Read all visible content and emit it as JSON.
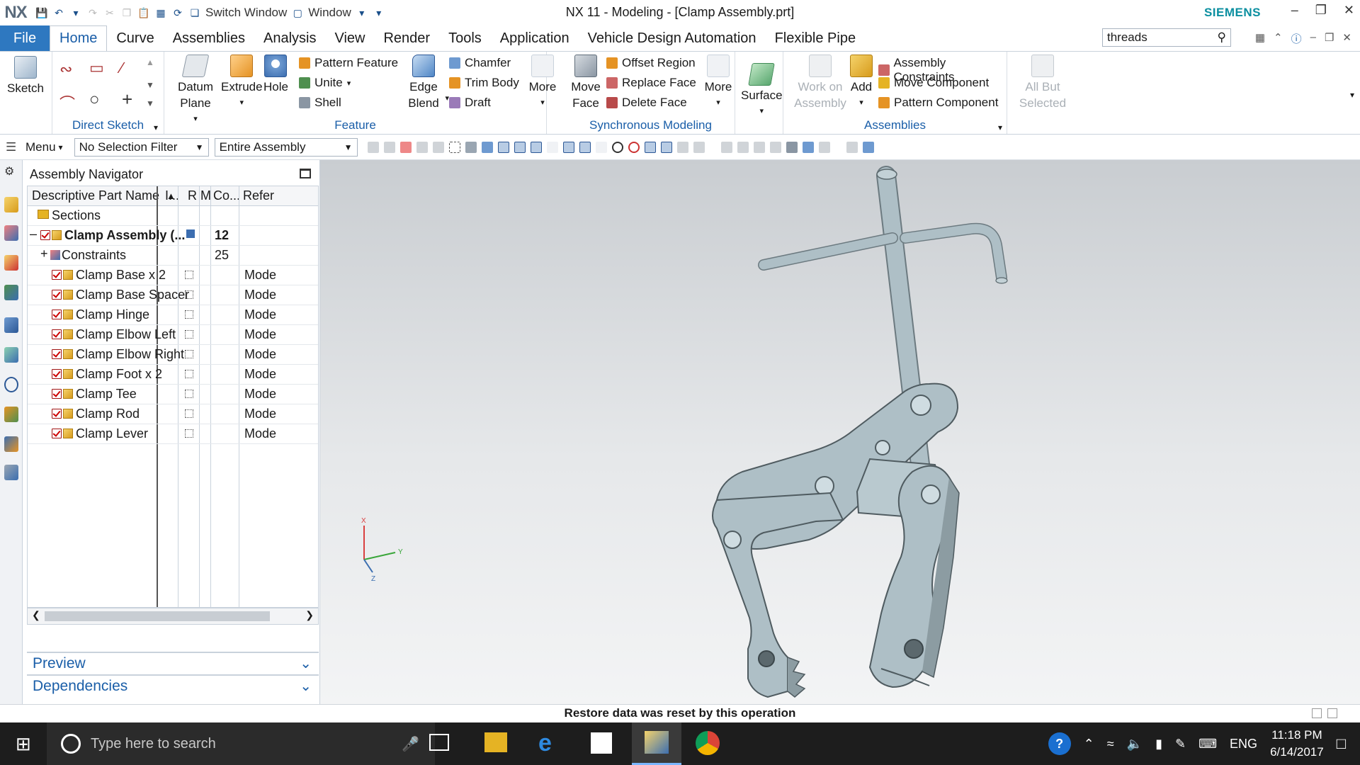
{
  "app": {
    "logo": "NX",
    "title": "NX 11 - Modeling - [Clamp Assembly.prt]",
    "brand": "SIEMENS",
    "switch_window_label": "Switch Window",
    "window_menu_label": "Window",
    "brand_color": "#0b8fa0",
    "accent_color": "#2e78c0"
  },
  "tabs": [
    {
      "label": "File"
    },
    {
      "label": "Home"
    },
    {
      "label": "Curve"
    },
    {
      "label": "Assemblies"
    },
    {
      "label": "Analysis"
    },
    {
      "label": "View"
    },
    {
      "label": "Render"
    },
    {
      "label": "Tools"
    },
    {
      "label": "Application"
    },
    {
      "label": "Vehicle Design Automation"
    },
    {
      "label": "Flexible Pipe"
    }
  ],
  "command_finder": {
    "value": "threads"
  },
  "ribbon": {
    "sketch": {
      "label": "Sketch"
    },
    "direct_sketch": {
      "group_label": "Direct Sketch"
    },
    "feature": {
      "group_label": "Feature",
      "datum_plane": "Datum Plane",
      "extrude": "Extrude",
      "hole": "Hole",
      "pattern_feature": "Pattern Feature",
      "unite": "Unite",
      "shell": "Shell",
      "edge_blend": "Edge Blend",
      "chamfer": "Chamfer",
      "trim_body": "Trim Body",
      "draft": "Draft",
      "more": "More"
    },
    "sync": {
      "group_label": "Synchronous Modeling",
      "move_face": "Move Face",
      "offset_region": "Offset Region",
      "replace_face": "Replace Face",
      "delete_face": "Delete Face",
      "more": "More"
    },
    "surface": {
      "label": "Surface"
    },
    "assemblies": {
      "group_label": "Assemblies",
      "work_on_assembly": "Work on Assembly",
      "add": "Add",
      "assembly_constraints": "Assembly Constraints",
      "move_component": "Move Component",
      "pattern_component": "Pattern Component",
      "all_but_selected": "All But Selected"
    }
  },
  "selection_bar": {
    "menu_label": "Menu",
    "selection_filter": "No Selection Filter",
    "scope": "Entire Assembly"
  },
  "navigator": {
    "title": "Assembly Navigator",
    "columns": [
      "Descriptive Part Name",
      "I...",
      "R",
      "M",
      "Co...",
      "Refer"
    ],
    "rows": [
      {
        "name": "Sections",
        "count": "",
        "ref": ""
      },
      {
        "name": "Clamp Assembly (...",
        "count": "12",
        "ref": ""
      },
      {
        "name": "Constraints",
        "count": "25",
        "ref": ""
      },
      {
        "name": "Clamp Base x 2",
        "count": "",
        "ref": "Mode"
      },
      {
        "name": "Clamp Base Spacer",
        "count": "",
        "ref": "Mode"
      },
      {
        "name": "Clamp Hinge",
        "count": "",
        "ref": "Mode"
      },
      {
        "name": "Clamp Elbow Left",
        "count": "",
        "ref": "Mode"
      },
      {
        "name": "Clamp Elbow Right",
        "count": "",
        "ref": "Mode"
      },
      {
        "name": "Clamp Foot x 2",
        "count": "",
        "ref": "Mode"
      },
      {
        "name": "Clamp Tee",
        "count": "",
        "ref": "Mode"
      },
      {
        "name": "Clamp Rod",
        "count": "",
        "ref": "Mode"
      },
      {
        "name": "Clamp Lever",
        "count": "",
        "ref": "Mode"
      }
    ],
    "preview_label": "Preview",
    "dependencies_label": "Dependencies"
  },
  "triad": {
    "x": "X",
    "y": "Y",
    "z": "Z"
  },
  "status": {
    "message": "Restore data was reset by this operation"
  },
  "taskbar": {
    "search_placeholder": "Type here to search",
    "language": "ENG",
    "time": "11:18 PM",
    "date": "6/14/2017"
  }
}
